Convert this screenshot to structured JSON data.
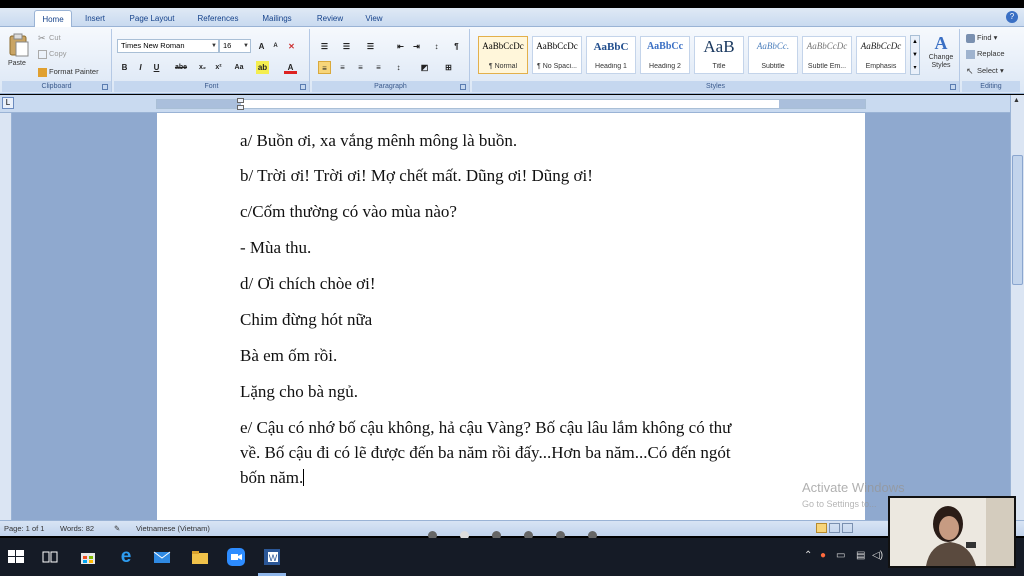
{
  "ribbon_tabs": [
    "Home",
    "Insert",
    "Page Layout",
    "References",
    "Mailings",
    "Review",
    "View"
  ],
  "clipboard": {
    "paste": "Paste",
    "cut": "Cut",
    "copy": "Copy",
    "format_painter": "Format Painter",
    "label": "Clipboard"
  },
  "font": {
    "name": "Times New Roman",
    "size": "16",
    "label": "Font"
  },
  "paragraph": {
    "label": "Paragraph"
  },
  "styles": {
    "label": "Styles",
    "items": [
      {
        "sample": "AaBbCcDc",
        "name": "¶ Normal"
      },
      {
        "sample": "AaBbCcDc",
        "name": "¶ No Spaci..."
      },
      {
        "sample": "AaBbC",
        "name": "Heading 1"
      },
      {
        "sample": "AaBbCc",
        "name": "Heading 2"
      },
      {
        "sample": "AaB",
        "name": "Title"
      },
      {
        "sample": "AaBbCc.",
        "name": "Subtitle"
      },
      {
        "sample": "AaBbCcDc",
        "name": "Subtle Em..."
      },
      {
        "sample": "AaBbCcDc",
        "name": "Emphasis"
      }
    ],
    "change_styles": "Change Styles"
  },
  "editing": {
    "find": "Find",
    "replace": "Replace",
    "select": "Select",
    "label": "Editing"
  },
  "document": {
    "lines": [
      "a/ Buồn ơi, xa vắng mênh mông là buồn.",
      "b/ Trời ơi! Trời ơi! Mợ chết mất. Dũng ơi! Dũng ơi!",
      "c/Cốm thường có vào mùa nào?",
      "- Mùa thu.",
      "d/  Ơi chích chòe ơi!",
      "Chim đừng hót nữa",
      "Bà em ốm rồi.",
      "Lặng cho bà ngủ.",
      "e/ Cậu có nhớ bố cậu không, hả cậu Vàng? Bố cậu lâu lắm không có thư",
      "về. Bố cậu đi có lẽ được đến ba năm rồi đấy...Hơn ba năm...Có đến ngót",
      "bốn năm."
    ]
  },
  "status": {
    "page": "Page: 1 of 1",
    "words": "Words: 82",
    "language": "Vietnamese (Vietnam)"
  },
  "watermark": {
    "title": "Activate Windows",
    "subtitle": "Go to Settings to..."
  },
  "colors": {
    "ribbon_blue": "#c9daf0",
    "doc_bg": "#8fa9cf",
    "taskbar": "#151b26"
  }
}
